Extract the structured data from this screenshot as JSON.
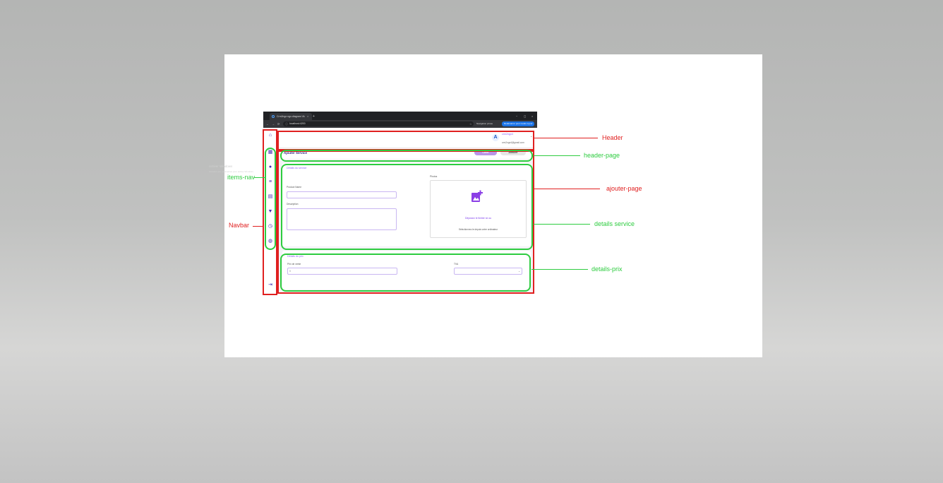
{
  "browser": {
    "tab_title": "Crm2ngx ngx-diagram Vk",
    "tab_close": "×",
    "new_tab": "+",
    "window_controls": [
      "−",
      "◻",
      "×"
    ],
    "nav_glyphs": [
      "←",
      "→",
      "⟳"
    ],
    "url": "localhost:4200",
    "nav_private": "Navigation privée",
    "relaunch_label": "Redémarrer pour mettre à jour"
  },
  "sidebar": {
    "icons": [
      "home-icon",
      "dashboard-icon",
      "user-icon",
      "list-icon",
      "database-icon",
      "cart-icon",
      "clock-icon",
      "palette-icon",
      "logout-icon"
    ]
  },
  "header": {
    "user_name": "crm2ngx4",
    "user_email": "crm2ngx4@gmail.com",
    "caret": "⌄"
  },
  "page_header": {
    "title": "Ajouter Service",
    "save_label": "Créer",
    "cancel_label": "Annuler"
  },
  "details_service": {
    "title": "Détails du service",
    "product_name_label": "Product Name",
    "description_label": "Description",
    "photos_label": "Photos",
    "dropzone_main": "Déposez le fichier ici ou",
    "dropzone_sub": "Sélectionnez-le depuis votre ordinateur"
  },
  "details_prix": {
    "title": "Détails du prix",
    "price_label": "Prix de vente",
    "price_value": "0",
    "tva_label": "TVA"
  },
  "watermark": {
    "line1": "Activer Windows",
    "line2": "Accédez aux paramètres pour activer Windows."
  },
  "annotations": {
    "header": "Header",
    "header_page": "header-page",
    "ajouter_page": "ajouter-page",
    "details_service": "details service",
    "details_prix": "details-prix",
    "items_nav": "items-nav",
    "navbar": "Navbar"
  },
  "colors": {
    "annotation_red": "#e02020",
    "annotation_green": "#2ecc40",
    "accent_purple": "#8b5cf6",
    "nav_icon": "#3d2db0"
  }
}
